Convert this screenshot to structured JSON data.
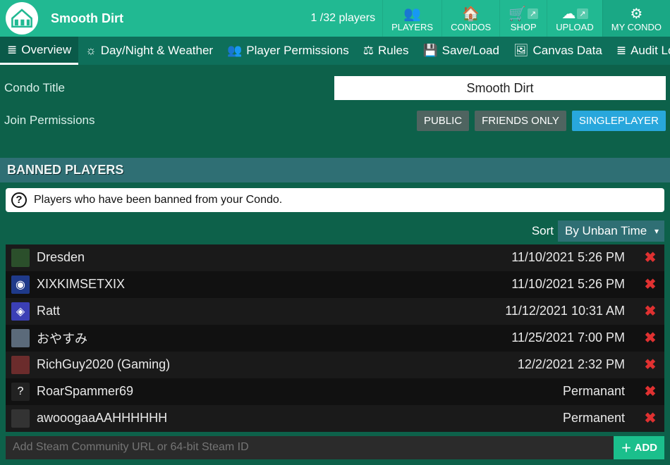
{
  "header": {
    "title": "Smooth Dirt",
    "player_count": "1 /32 players",
    "nav": [
      {
        "label": "PLAYERS",
        "icon": "👥"
      },
      {
        "label": "CONDOS",
        "icon": "🏠"
      },
      {
        "label": "SHOP",
        "icon": "🛒",
        "ext": true
      },
      {
        "label": "UPLOAD",
        "icon": "☁",
        "ext": true
      },
      {
        "label": "MY CONDO",
        "icon": "⚙",
        "active": true
      }
    ]
  },
  "tabs": [
    {
      "label": "Overview",
      "icon": "≣",
      "active": true
    },
    {
      "label": "Day/Night & Weather",
      "icon": "☼"
    },
    {
      "label": "Player Permissions",
      "icon": "👥"
    },
    {
      "label": "Rules",
      "icon": "⚖"
    },
    {
      "label": "Save/Load",
      "icon": "💾"
    },
    {
      "label": "Canvas Data",
      "icon": "🖼"
    }
  ],
  "audit_tab": {
    "label": "Audit Log",
    "icon": "≣"
  },
  "config": {
    "condo_title_label": "Condo Title",
    "condo_title_value": "Smooth Dirt",
    "join_label": "Join Permissions",
    "join_options": [
      {
        "label": "PUBLIC"
      },
      {
        "label": "FRIENDS ONLY"
      },
      {
        "label": "SINGLEPLAYER",
        "active": true
      }
    ]
  },
  "banned": {
    "header": "BANNED PLAYERS",
    "desc": "Players who have been banned from your Condo.",
    "sort_label": "Sort",
    "sort_value": "By Unban Time",
    "rows": [
      {
        "name": "Dresden",
        "time": "11/10/2021 5:26 PM",
        "avatar_bg": "#2b4f2b",
        "avatar_txt": ""
      },
      {
        "name": "XIXKIMSETXIX",
        "time": "11/10/2021 5:26 PM",
        "avatar_bg": "#1f3a8a",
        "avatar_txt": "◉"
      },
      {
        "name": "Ratt",
        "time": "11/12/2021 10:31 AM",
        "avatar_bg": "#3b3fb5",
        "avatar_txt": "◈"
      },
      {
        "name": "おやすみ",
        "time": "11/25/2021 7:00 PM",
        "avatar_bg": "#5b6a7a",
        "avatar_txt": ""
      },
      {
        "name": "RichGuy2020 (Gaming)",
        "time": "12/2/2021 2:32 PM",
        "avatar_bg": "#6b2c2c",
        "avatar_txt": ""
      },
      {
        "name": "RoarSpammer69",
        "time": "Permanant",
        "avatar_bg": "#222222",
        "avatar_txt": "?"
      },
      {
        "name": "awooogaaAAHHHHHH",
        "time": "Permanent",
        "avatar_bg": "#333333",
        "avatar_txt": ""
      }
    ],
    "add_placeholder": "Add Steam Community URL or 64-bit Steam ID",
    "add_label": "ADD"
  }
}
